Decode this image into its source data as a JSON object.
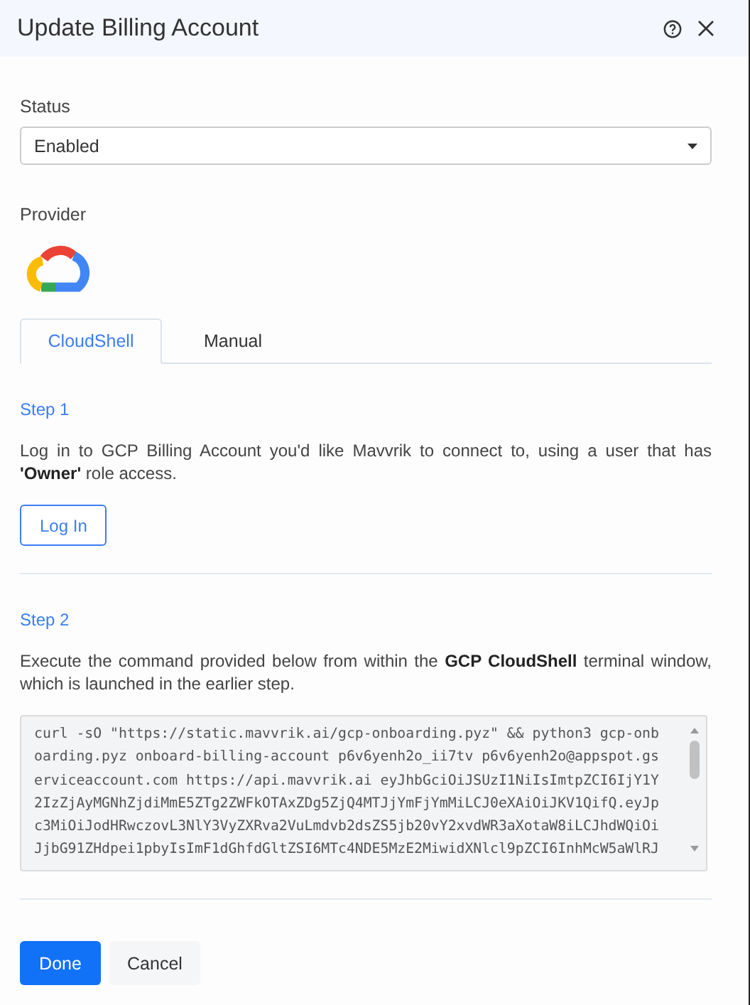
{
  "dialog": {
    "title": "Update Billing Account"
  },
  "status": {
    "label": "Status",
    "value": "Enabled"
  },
  "provider": {
    "label": "Provider"
  },
  "tabs": [
    {
      "label": "CloudShell",
      "selected": true
    },
    {
      "label": "Manual",
      "selected": false
    }
  ],
  "step1": {
    "heading": "Step 1",
    "text": "Log in to GCP Billing Account you'd like Mavvrik to connect to, using a user that has **'Owner'** role access.",
    "button": "Log In"
  },
  "step2": {
    "heading": "Step 2",
    "text": "Execute the command provided below from within the **GCP CloudShell** terminal window, which is launched in the earlier step.",
    "command_lines": [
      "curl -sO \"https://static.mavvrik.ai/gcp-onboarding.pyz\" && python3 gcp-onb",
      "oarding.pyz onboard-billing-account p6v6yenh2o_ii7tv p6v6yenh2o@appspot.gs",
      "erviceaccount.com https://api.mavvrik.ai eyJhbGciOiJSUzI1NiIsImtpZCI6IjY1Y",
      "2IzZjAyMGNhZjdiMmE5ZTg2ZWFkOTAxZDg5ZjQ4MTJjYmFjYmMiLCJ0eXAiOiJKV1QifQ.eyJp",
      "c3MiOiJodHRwczovL3NlY3VyZXRva2VuLmdvb2dsZS5jb20vY2xvdWR3aXotaW8iLCJhdWQiOi",
      "JjbG91ZHdpei1pbyIsImF1dGhfdGltZSI6MTc4NDE5MzE2MiwidXNlcl9pZCI6InhMcW5aWlRJ"
    ]
  },
  "buttons": [
    {
      "label": "Done",
      "kind": "primary"
    },
    {
      "label": "Cancel",
      "kind": "secondary"
    }
  ]
}
